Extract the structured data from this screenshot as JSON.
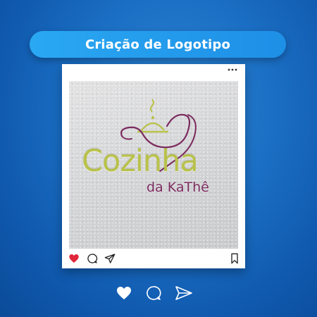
{
  "banner": {
    "title": "Criação de Logotipo"
  },
  "post": {
    "logo": {
      "main_text": "Cozinha",
      "sub_text": "da KaThê"
    },
    "colors": {
      "logo_green": "#b9c24a",
      "logo_purple": "#7b2b5f",
      "like_red": "#e0273a"
    },
    "actions": [
      "heart-icon",
      "comment-icon",
      "share-icon",
      "bookmark-icon"
    ]
  },
  "footer_actions": [
    "heart-icon",
    "comment-icon",
    "share-icon"
  ]
}
